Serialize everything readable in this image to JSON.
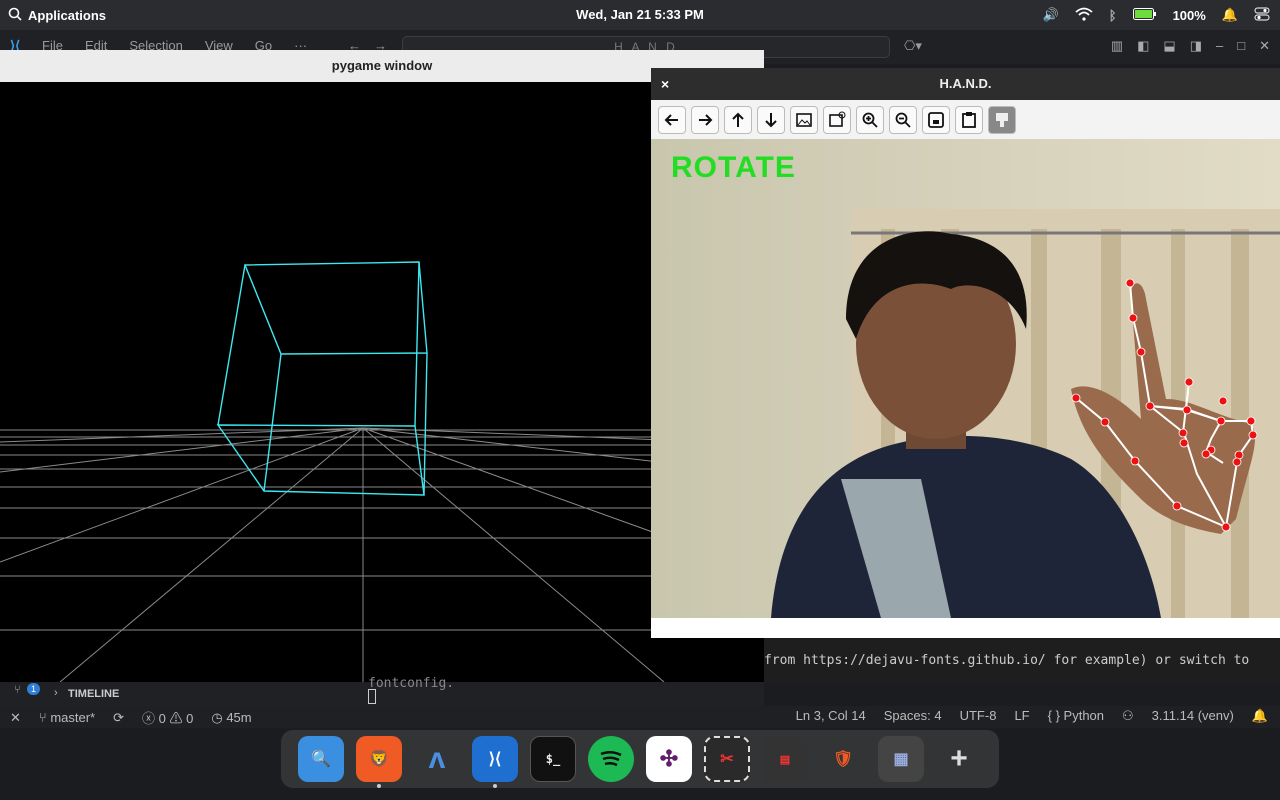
{
  "menubar": {
    "apps_label": "Applications",
    "datetime": "Wed, Jan 21   5:33 PM",
    "battery": "100%"
  },
  "vscode": {
    "menu": [
      "File",
      "Edit",
      "Selection",
      "View",
      "Go",
      "···"
    ],
    "search_text": "H A N D"
  },
  "pygame": {
    "title": "pygame window",
    "wire_color": "#3ee8f0"
  },
  "hand_window": {
    "title": "H.A.N.D.",
    "close": "×",
    "gesture_label": "ROTATE",
    "toolbar_icons": [
      "back-icon",
      "forward-icon",
      "up-icon",
      "down-icon",
      "image-icon",
      "image-settings-icon",
      "zoom-in-icon",
      "zoom-out-icon",
      "save-icon",
      "clipboard-icon",
      "paint-icon"
    ]
  },
  "terminal": {
    "line": "from https://dejavu-fonts.github.io/ for example) or switch to",
    "partial": "fontconfig."
  },
  "panel": {
    "badge": "1",
    "timeline": "TIMELINE"
  },
  "statusbar": {
    "branch": "master*",
    "errors": "0",
    "warnings": "0",
    "time": "45m",
    "position": "Ln 3, Col 14",
    "spaces": "Spaces: 4",
    "encoding": "UTF-8",
    "eol": "LF",
    "language": "Python",
    "interpreter": "3.11.14 (venv)"
  },
  "dock": [
    "finder-icon",
    "brave-icon",
    "arc-icon",
    "vscode-icon",
    "terminal-icon",
    "spotify-icon",
    "slack-icon",
    "screenshot-icon",
    "app-icon",
    "brave-small-icon",
    "vscode-group-icon",
    "add-icon"
  ]
}
